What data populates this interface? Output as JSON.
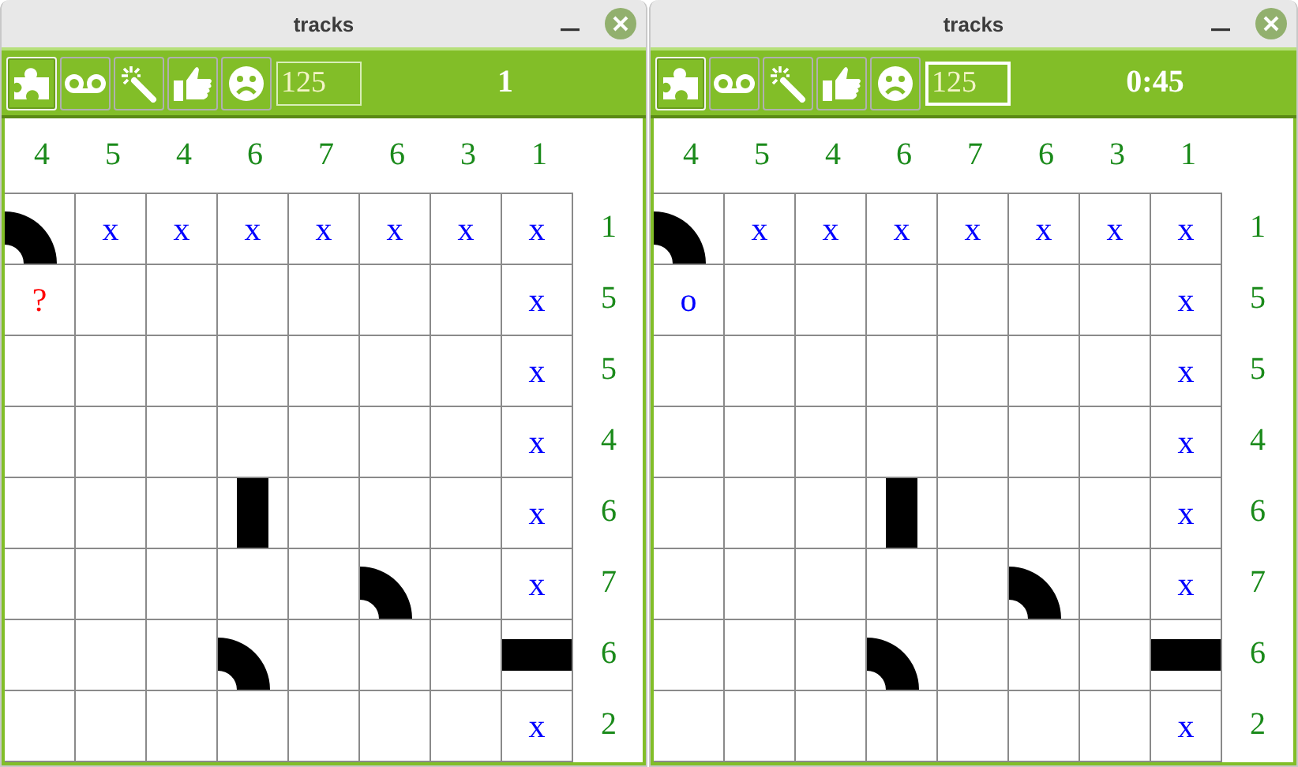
{
  "windows": [
    {
      "title": "tracks",
      "tools": [
        {
          "selected": true
        },
        {
          "selected": false
        },
        {
          "selected": false
        },
        {
          "selected": false
        },
        {
          "selected": false
        }
      ],
      "size_field": {
        "value": "125",
        "focused": false
      },
      "status": "1",
      "column_clues": [
        "4",
        "5",
        "4",
        "6",
        "7",
        "6",
        "3",
        "1"
      ],
      "row_clues": [
        "1",
        "5",
        "5",
        "4",
        "6",
        "7",
        "6",
        "2"
      ],
      "rows": [
        [
          {
            "kind": "curve"
          },
          {
            "kind": "mark",
            "text": "x",
            "color": "#0000ff"
          },
          {
            "kind": "mark",
            "text": "x",
            "color": "#0000ff"
          },
          {
            "kind": "mark",
            "text": "x",
            "color": "#0000ff"
          },
          {
            "kind": "mark",
            "text": "x",
            "color": "#0000ff"
          },
          {
            "kind": "mark",
            "text": "x",
            "color": "#0000ff"
          },
          {
            "kind": "mark",
            "text": "x",
            "color": "#0000ff"
          },
          {
            "kind": "mark",
            "text": "x",
            "color": "#0000ff"
          }
        ],
        [
          {
            "kind": "mark",
            "text": "?",
            "color": "#ff0000"
          },
          {
            "kind": "empty"
          },
          {
            "kind": "empty"
          },
          {
            "kind": "empty"
          },
          {
            "kind": "empty"
          },
          {
            "kind": "empty"
          },
          {
            "kind": "empty"
          },
          {
            "kind": "mark",
            "text": "x",
            "color": "#0000ff"
          }
        ],
        [
          {
            "kind": "empty"
          },
          {
            "kind": "empty"
          },
          {
            "kind": "empty"
          },
          {
            "kind": "empty"
          },
          {
            "kind": "empty"
          },
          {
            "kind": "empty"
          },
          {
            "kind": "empty"
          },
          {
            "kind": "mark",
            "text": "x",
            "color": "#0000ff"
          }
        ],
        [
          {
            "kind": "empty"
          },
          {
            "kind": "empty"
          },
          {
            "kind": "empty"
          },
          {
            "kind": "empty"
          },
          {
            "kind": "empty"
          },
          {
            "kind": "empty"
          },
          {
            "kind": "empty"
          },
          {
            "kind": "mark",
            "text": "x",
            "color": "#0000ff"
          }
        ],
        [
          {
            "kind": "empty"
          },
          {
            "kind": "empty"
          },
          {
            "kind": "empty"
          },
          {
            "kind": "vertical"
          },
          {
            "kind": "empty"
          },
          {
            "kind": "empty"
          },
          {
            "kind": "empty"
          },
          {
            "kind": "mark",
            "text": "x",
            "color": "#0000ff"
          }
        ],
        [
          {
            "kind": "empty"
          },
          {
            "kind": "empty"
          },
          {
            "kind": "empty"
          },
          {
            "kind": "empty"
          },
          {
            "kind": "empty"
          },
          {
            "kind": "curve"
          },
          {
            "kind": "empty"
          },
          {
            "kind": "mark",
            "text": "x",
            "color": "#0000ff"
          }
        ],
        [
          {
            "kind": "empty"
          },
          {
            "kind": "empty"
          },
          {
            "kind": "empty"
          },
          {
            "kind": "curve"
          },
          {
            "kind": "empty"
          },
          {
            "kind": "empty"
          },
          {
            "kind": "empty"
          },
          {
            "kind": "horizontal"
          }
        ],
        [
          {
            "kind": "empty"
          },
          {
            "kind": "empty"
          },
          {
            "kind": "empty"
          },
          {
            "kind": "empty"
          },
          {
            "kind": "empty"
          },
          {
            "kind": "empty"
          },
          {
            "kind": "empty"
          },
          {
            "kind": "mark",
            "text": "x",
            "color": "#0000ff"
          }
        ]
      ]
    },
    {
      "title": "tracks",
      "tools": [
        {
          "selected": true
        },
        {
          "selected": false
        },
        {
          "selected": false
        },
        {
          "selected": false
        },
        {
          "selected": false
        }
      ],
      "size_field": {
        "value": "125",
        "focused": true
      },
      "status": "0:45",
      "column_clues": [
        "4",
        "5",
        "4",
        "6",
        "7",
        "6",
        "3",
        "1"
      ],
      "row_clues": [
        "1",
        "5",
        "5",
        "4",
        "6",
        "7",
        "6",
        "2"
      ],
      "rows": [
        [
          {
            "kind": "curve"
          },
          {
            "kind": "mark",
            "text": "x",
            "color": "#0000ff"
          },
          {
            "kind": "mark",
            "text": "x",
            "color": "#0000ff"
          },
          {
            "kind": "mark",
            "text": "x",
            "color": "#0000ff"
          },
          {
            "kind": "mark",
            "text": "x",
            "color": "#0000ff"
          },
          {
            "kind": "mark",
            "text": "x",
            "color": "#0000ff"
          },
          {
            "kind": "mark",
            "text": "x",
            "color": "#0000ff"
          },
          {
            "kind": "mark",
            "text": "x",
            "color": "#0000ff"
          }
        ],
        [
          {
            "kind": "mark",
            "text": "o",
            "color": "#0000ff"
          },
          {
            "kind": "empty"
          },
          {
            "kind": "empty"
          },
          {
            "kind": "empty"
          },
          {
            "kind": "empty"
          },
          {
            "kind": "empty"
          },
          {
            "kind": "empty"
          },
          {
            "kind": "mark",
            "text": "x",
            "color": "#0000ff"
          }
        ],
        [
          {
            "kind": "empty"
          },
          {
            "kind": "empty"
          },
          {
            "kind": "empty"
          },
          {
            "kind": "empty"
          },
          {
            "kind": "empty"
          },
          {
            "kind": "empty"
          },
          {
            "kind": "empty"
          },
          {
            "kind": "mark",
            "text": "x",
            "color": "#0000ff"
          }
        ],
        [
          {
            "kind": "empty"
          },
          {
            "kind": "empty"
          },
          {
            "kind": "empty"
          },
          {
            "kind": "empty"
          },
          {
            "kind": "empty"
          },
          {
            "kind": "empty"
          },
          {
            "kind": "empty"
          },
          {
            "kind": "mark",
            "text": "x",
            "color": "#0000ff"
          }
        ],
        [
          {
            "kind": "empty"
          },
          {
            "kind": "empty"
          },
          {
            "kind": "empty"
          },
          {
            "kind": "vertical"
          },
          {
            "kind": "empty"
          },
          {
            "kind": "empty"
          },
          {
            "kind": "empty"
          },
          {
            "kind": "mark",
            "text": "x",
            "color": "#0000ff"
          }
        ],
        [
          {
            "kind": "empty"
          },
          {
            "kind": "empty"
          },
          {
            "kind": "empty"
          },
          {
            "kind": "empty"
          },
          {
            "kind": "empty"
          },
          {
            "kind": "curve"
          },
          {
            "kind": "empty"
          },
          {
            "kind": "mark",
            "text": "x",
            "color": "#0000ff"
          }
        ],
        [
          {
            "kind": "empty"
          },
          {
            "kind": "empty"
          },
          {
            "kind": "empty"
          },
          {
            "kind": "curve"
          },
          {
            "kind": "empty"
          },
          {
            "kind": "empty"
          },
          {
            "kind": "empty"
          },
          {
            "kind": "horizontal"
          }
        ],
        [
          {
            "kind": "empty"
          },
          {
            "kind": "empty"
          },
          {
            "kind": "empty"
          },
          {
            "kind": "empty"
          },
          {
            "kind": "empty"
          },
          {
            "kind": "empty"
          },
          {
            "kind": "empty"
          },
          {
            "kind": "mark",
            "text": "x",
            "color": "#0000ff"
          }
        ]
      ]
    }
  ]
}
